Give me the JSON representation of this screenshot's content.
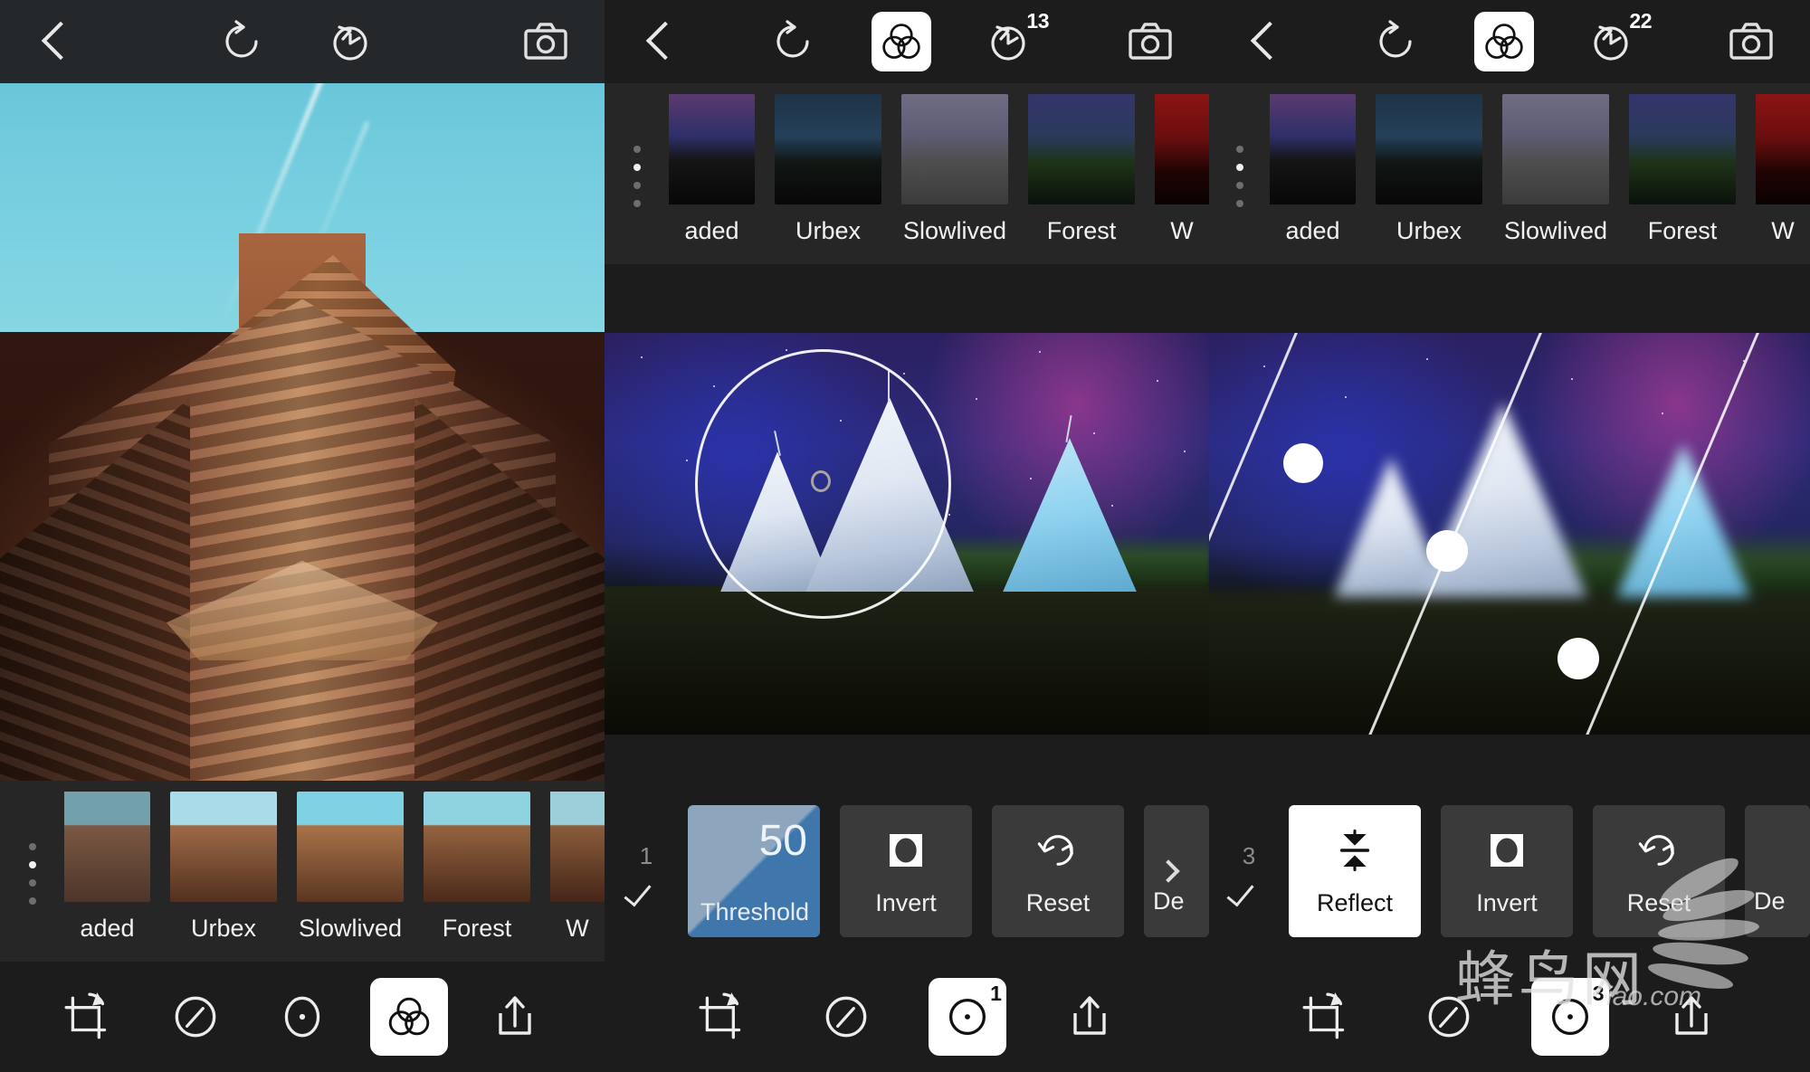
{
  "app": {
    "watermark_text": "蜂鸟网",
    "watermark_sub": "iao.com"
  },
  "icons": {
    "back": "chevron-left-icon",
    "undo": "undo-icon",
    "history": "history-icon",
    "camera": "camera-icon",
    "filters": "filters-icon",
    "crop": "crop-rotate-icon",
    "adjust": "adjust-dial-icon",
    "blur": "radial-blur-icon",
    "share": "share-icon",
    "invert": "invert-icon",
    "reset": "reset-icon",
    "reflect": "reflect-icon"
  },
  "filters": {
    "items": [
      {
        "label": "aded"
      },
      {
        "label": "Urbex"
      },
      {
        "label": "Slowlived"
      },
      {
        "label": "Forest"
      },
      {
        "label": "W"
      }
    ],
    "page_dots": 4,
    "active_dot": 1
  },
  "panel1": {
    "topbar": {
      "back": "‹",
      "undo": "undo",
      "history": "history",
      "history_badge": "",
      "camera": "camera"
    },
    "bottom_nav": [
      {
        "name": "crop",
        "selected": false,
        "badge": ""
      },
      {
        "name": "adjust",
        "selected": false,
        "badge": ""
      },
      {
        "name": "blur",
        "selected": false,
        "badge": ""
      },
      {
        "name": "filters",
        "selected": true,
        "badge": ""
      },
      {
        "name": "share",
        "selected": false,
        "badge": ""
      }
    ]
  },
  "panel2": {
    "topbar": {
      "history_badge": "13"
    },
    "step_number": "1",
    "tools": [
      {
        "label": "Threshold",
        "value": "50",
        "type": "slider",
        "active": false
      },
      {
        "label": "Invert",
        "type": "button",
        "active": false
      },
      {
        "label": "Reset",
        "type": "button",
        "active": false
      },
      {
        "label": "De",
        "type": "button",
        "active": false
      }
    ],
    "bottom_nav": [
      {
        "name": "crop",
        "selected": false,
        "badge": ""
      },
      {
        "name": "adjust",
        "selected": false,
        "badge": ""
      },
      {
        "name": "blur",
        "selected": true,
        "badge": "1"
      },
      {
        "name": "share",
        "selected": false,
        "badge": ""
      }
    ]
  },
  "panel3": {
    "topbar": {
      "history_badge": "22"
    },
    "step_number": "3",
    "tools": [
      {
        "label": "Reflect",
        "type": "button",
        "active": true
      },
      {
        "label": "Invert",
        "type": "button",
        "active": false
      },
      {
        "label": "Reset",
        "type": "button",
        "active": false
      },
      {
        "label": "De",
        "type": "button",
        "active": false
      }
    ],
    "bottom_nav": [
      {
        "name": "crop",
        "selected": false,
        "badge": ""
      },
      {
        "name": "adjust",
        "selected": false,
        "badge": ""
      },
      {
        "name": "blur",
        "selected": true,
        "badge": "3"
      },
      {
        "name": "share",
        "selected": false,
        "badge": ""
      }
    ]
  },
  "colors": {
    "background": "#1c1c1c",
    "strip": "#262626",
    "tile": "#3a3a3a",
    "tile_active": "#ffffff",
    "threshold_blue": "#3f77ad",
    "threshold_grey": "#8ea6bd",
    "text": "#f0f0f0"
  }
}
